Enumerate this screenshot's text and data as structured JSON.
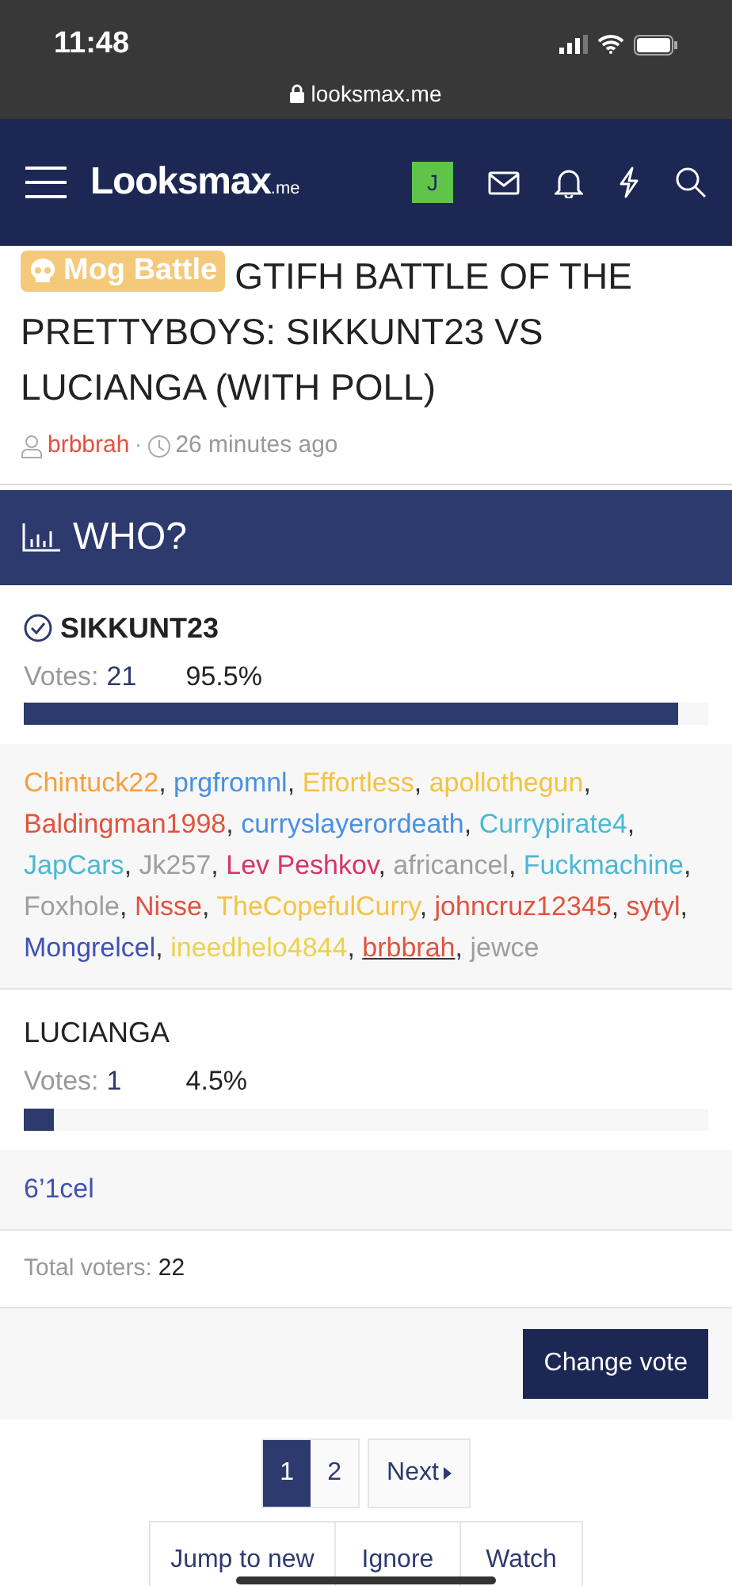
{
  "status_bar": {
    "time": "11:48",
    "url": "looksmax.me"
  },
  "nav": {
    "logo": "Looksmax",
    "logo_suffix": ".me",
    "avatar_letter": "J"
  },
  "thread": {
    "prefix": "Mog Battle",
    "title": "GTIFH BATTLE OF THE PRETTYBOYS: SIKKUNT23 VS LUCIANGA (WITH POLL)",
    "author": "brbbrah",
    "separator": "·",
    "time": "26 minutes ago"
  },
  "poll": {
    "title": "WHO?",
    "options": [
      {
        "label": "SIKKUNT23",
        "selected": true,
        "votes_label": "Votes:",
        "votes": "21",
        "percent": "95.5%",
        "level": 0.955,
        "voters": [
          {
            "name": "Chintuck22",
            "color": "#f6a03c",
            "underlined": false
          },
          {
            "name": "prgfromnl",
            "color": "#4a90e2",
            "underlined": false
          },
          {
            "name": "Effortless",
            "color": "#f5c342",
            "underlined": false
          },
          {
            "name": "apollothegun",
            "color": "#f5c342",
            "underlined": false
          },
          {
            "name": "Baldingman1998",
            "color": "#e0533f",
            "underlined": false
          },
          {
            "name": "curryslayerordeath",
            "color": "#4a90e2",
            "underlined": false
          },
          {
            "name": "Currypirate4",
            "color": "#4bb8d4",
            "underlined": false
          },
          {
            "name": "JapCars",
            "color": "#4bb8d4",
            "underlined": false
          },
          {
            "name": "Jk257",
            "color": "#9e9e9e",
            "underlined": false
          },
          {
            "name": "Lev Peshkov",
            "color": "#d6336c",
            "underlined": false
          },
          {
            "name": "africancel",
            "color": "#9e9e9e",
            "underlined": false
          },
          {
            "name": "Fuckmachine",
            "color": "#4bb8d4",
            "underlined": false
          },
          {
            "name": "Foxhole",
            "color": "#9e9e9e",
            "underlined": false
          },
          {
            "name": "Nisse",
            "color": "#e0533f",
            "underlined": false
          },
          {
            "name": "TheCopefulCurry",
            "color": "#f5c342",
            "underlined": false
          },
          {
            "name": "johncruz12345",
            "color": "#e0533f",
            "underlined": false
          },
          {
            "name": "sytyl",
            "color": "#e0533f",
            "underlined": false
          },
          {
            "name": "Mongrelcel",
            "color": "#3f51b5",
            "underlined": false
          },
          {
            "name": "ineedhelo4844",
            "color": "#ecd24a",
            "underlined": false
          },
          {
            "name": "brbbrah",
            "color": "#e0533f",
            "underlined": true
          },
          {
            "name": "jewce",
            "color": "#9e9e9e",
            "underlined": false
          }
        ]
      },
      {
        "label": "LUCIANGA",
        "selected": false,
        "votes_label": "Votes:",
        "votes": "1",
        "percent": "4.5%",
        "level": 0.045,
        "voters": [
          {
            "name": "6’1cel",
            "color": "#3f51b5",
            "underlined": false
          }
        ]
      }
    ],
    "voter_separator": ",",
    "total_label": "Total voters:",
    "total": "22",
    "button": "Change vote"
  },
  "pagination": [
    {
      "label": "1",
      "selected": true
    },
    {
      "label": "2",
      "selected": false
    }
  ],
  "next": "Next",
  "actions": [
    "Jump to new",
    "Ignore",
    "Watch"
  ]
}
